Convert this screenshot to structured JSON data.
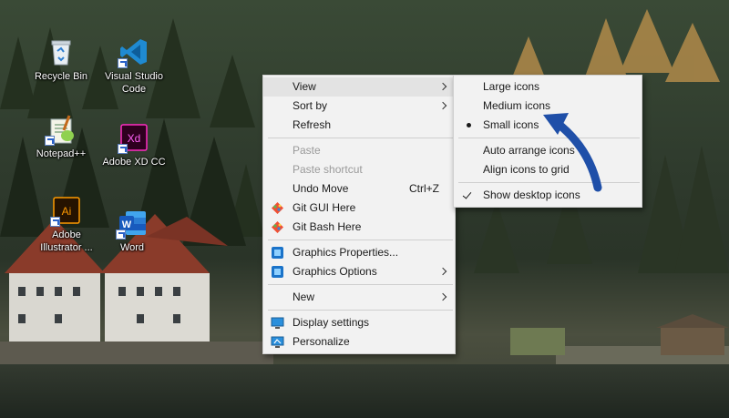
{
  "desktop": {
    "icons": [
      {
        "label": "Recycle Bin",
        "icon": "recycle-bin-icon"
      },
      {
        "label": "Visual Studio Code",
        "icon": "vscode-icon"
      },
      {
        "label": "Notepad++",
        "icon": "notepad-plus-plus-icon"
      },
      {
        "label": "Adobe XD CC",
        "icon": "adobe-xd-icon"
      },
      {
        "label": "Adobe Illustrator ...",
        "icon": "adobe-illustrator-icon"
      },
      {
        "label": "Word",
        "icon": "word-icon"
      }
    ]
  },
  "context_menu": {
    "items": [
      {
        "label": "View",
        "has_submenu": true,
        "state": "highlighted"
      },
      {
        "label": "Sort by",
        "has_submenu": true
      },
      {
        "label": "Refresh"
      },
      {
        "label": "Paste",
        "disabled": true
      },
      {
        "label": "Paste shortcut",
        "disabled": true
      },
      {
        "label": "Undo Move",
        "shortcut": "Ctrl+Z"
      },
      {
        "label": "Git GUI Here",
        "icon": "git-gui-icon"
      },
      {
        "label": "Git Bash Here",
        "icon": "git-bash-icon"
      },
      {
        "label": "Graphics Properties...",
        "icon": "intel-graphics-icon"
      },
      {
        "label": "Graphics Options",
        "icon": "intel-graphics-icon",
        "has_submenu": true
      },
      {
        "label": "New",
        "has_submenu": true
      },
      {
        "label": "Display settings",
        "icon": "display-icon"
      },
      {
        "label": "Personalize",
        "icon": "personalize-icon"
      }
    ]
  },
  "view_submenu": {
    "items": [
      {
        "label": "Large icons"
      },
      {
        "label": "Medium icons"
      },
      {
        "label": "Small icons",
        "selected": true
      },
      {
        "label": "Auto arrange icons"
      },
      {
        "label": "Align icons to grid"
      },
      {
        "label": "Show desktop icons",
        "checked": true
      }
    ]
  },
  "annotation": {
    "type": "arrow",
    "color": "#1f4fa8"
  },
  "colors": {
    "menu_bg": "#f2f2f2",
    "menu_border": "#cfcfcf",
    "highlight": "#e3e3e3",
    "disabled_text": "#9a9a9a"
  }
}
